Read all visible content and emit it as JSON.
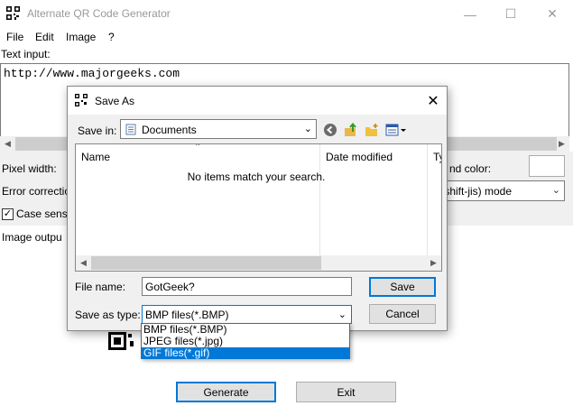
{
  "window": {
    "title": "Alternate QR Code Generator",
    "minimize_glyph": "—",
    "maximize_glyph": "☐",
    "close_glyph": "✕"
  },
  "menu": [
    "File",
    "Edit",
    "Image",
    "?"
  ],
  "main": {
    "text_input_label": "Text input:",
    "text_value": "http://www.majorgeeks.com",
    "pixel_width_label": "Pixel width:",
    "error_correction_label": "Error correctio",
    "case_sensitive_label": "Case sensit",
    "case_sensitive_checked": true,
    "background_color_label": "nd color:",
    "mode_value": "nji (shift-jis) mode",
    "image_output_label": "Image outpu",
    "generate_label": "Generate",
    "exit_label": "Exit"
  },
  "dialog": {
    "title": "Save As",
    "close_glyph": "✕",
    "save_in_label": "Save in:",
    "save_in_value": "Documents",
    "columns": [
      "Name",
      "Date modified",
      "Ty"
    ],
    "empty_message": "No items match your search.",
    "file_name_label": "File name:",
    "file_name_value": "GotGeek?",
    "save_as_type_label": "Save as type:",
    "save_as_type_value": "BMP files(*.BMP)",
    "save_label": "Save",
    "cancel_label": "Cancel",
    "type_options": [
      {
        "label": "BMP files(*.BMP)",
        "selected": false
      },
      {
        "label": "JPEG files(*.jpg)",
        "selected": false
      },
      {
        "label": "GIF files(*.gif)",
        "selected": true
      }
    ]
  },
  "colors": {
    "accent": "#0078d7",
    "panel": "#f0f0f0",
    "title_text_inactive": "#999999"
  },
  "icons": [
    "qr-code-icon",
    "folder-icon",
    "back-arrow-icon",
    "up-folder-icon",
    "new-folder-icon",
    "view-menu-icon"
  ]
}
